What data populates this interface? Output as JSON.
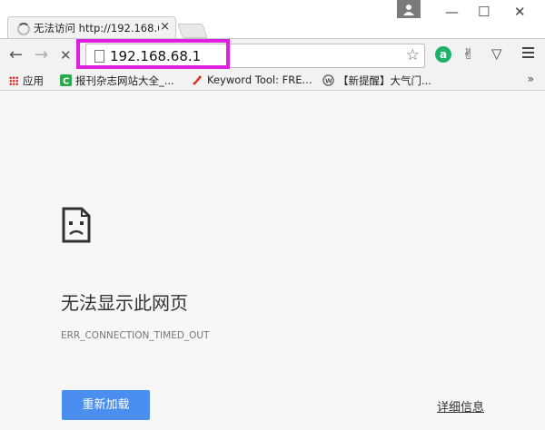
{
  "tab": {
    "title": "无法访问 http://192.168.6",
    "close": "×"
  },
  "window": {
    "minimize": "—",
    "maximize": "☐",
    "close": "✕"
  },
  "toolbar": {
    "back": "←",
    "forward": "→",
    "stop": "✕",
    "url": "192.168.68.1",
    "bookmark_star": "☆"
  },
  "extensions": {
    "ext1": "a",
    "ext2": "✌",
    "ext3": "▽"
  },
  "bookmarks": {
    "items": [
      {
        "label": "应用",
        "icon": "apps-icon"
      },
      {
        "label": "报刊杂志网站大全_...",
        "icon": "c-site-icon"
      },
      {
        "label": "Keyword Tool: FRE...",
        "icon": "keyword-tool-icon"
      },
      {
        "label": "【新提醒】大气门...",
        "icon": "wordpress-icon"
      }
    ],
    "more": "»"
  },
  "error": {
    "icon": "sad-page-icon",
    "title": "无法显示此网页",
    "code": "ERR_CONNECTION_TIMED_OUT",
    "reload_label": "重新加载",
    "details_label": "详细信息"
  },
  "colors": {
    "highlight": "#e020e0",
    "reload_button": "#4a8ef0"
  }
}
